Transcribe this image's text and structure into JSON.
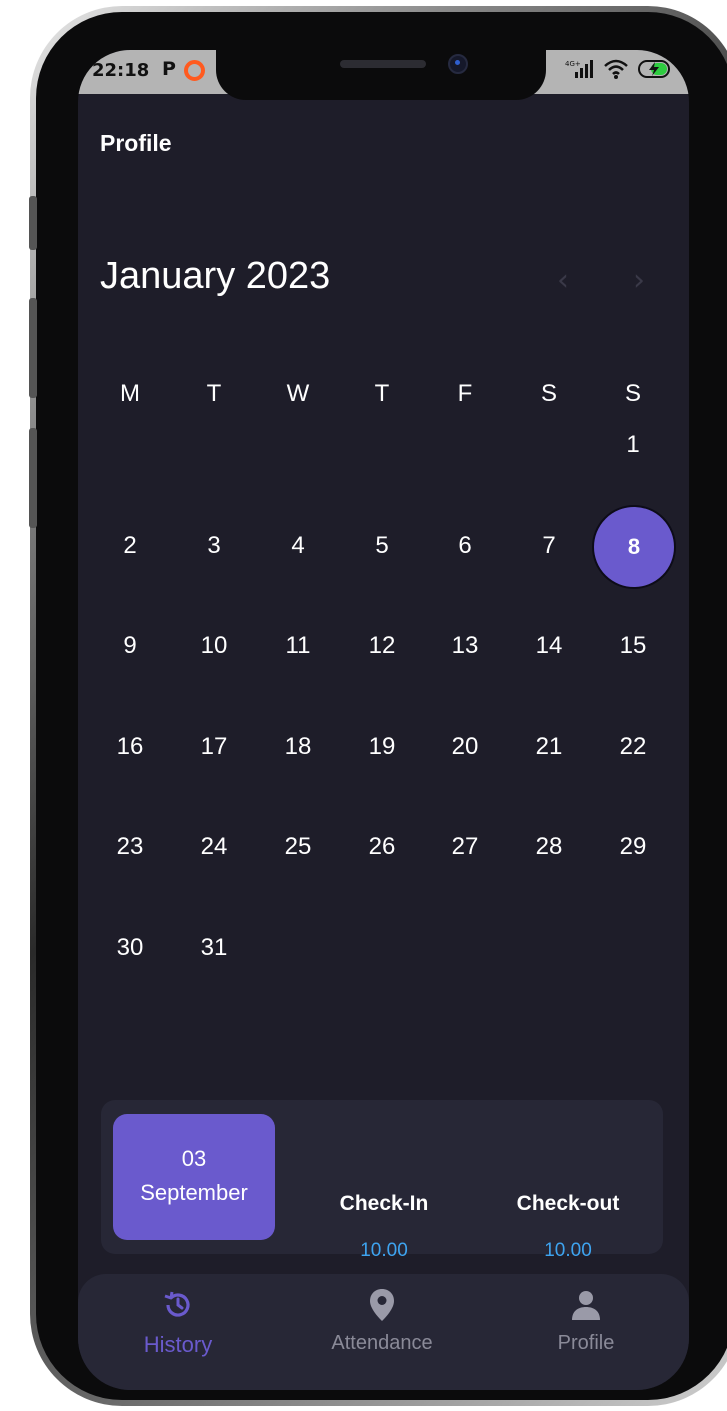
{
  "status_bar": {
    "time": "22:18",
    "left_icons": [
      "p-icon",
      "opera-icon"
    ],
    "right_icons": [
      "signal-icon",
      "wifi-icon",
      "battery-charging-icon"
    ]
  },
  "header": {
    "title": "Profile"
  },
  "calendar": {
    "month_title": "January 2023",
    "prev_icon": "chevron-left-icon",
    "next_icon": "chevron-right-icon",
    "weekdays": [
      "M",
      "T",
      "W",
      "T",
      "F",
      "S",
      "S"
    ],
    "selected_day": "8",
    "weeks": [
      [
        "",
        "",
        "",
        "",
        "",
        "",
        "1"
      ],
      [
        "2",
        "3",
        "4",
        "5",
        "6",
        "7",
        "8"
      ],
      [
        "9",
        "10",
        "11",
        "12",
        "13",
        "14",
        "15"
      ],
      [
        "16",
        "17",
        "18",
        "19",
        "20",
        "21",
        "22"
      ],
      [
        "23",
        "24",
        "25",
        "26",
        "27",
        "28",
        "29"
      ],
      [
        "30",
        "31",
        "",
        "",
        "",
        "",
        ""
      ]
    ]
  },
  "summary": {
    "day": "03",
    "month": "September",
    "check_in_label": "Check-In",
    "check_in_value": "10.00",
    "check_out_label": "Check-out",
    "check_out_value": "10.00"
  },
  "bottom_nav": {
    "items": [
      {
        "label": "History",
        "icon": "history-icon",
        "active": true
      },
      {
        "label": "Attendance",
        "icon": "location-pin-icon",
        "active": false
      },
      {
        "label": "Profile",
        "icon": "person-icon",
        "active": false
      }
    ]
  },
  "colors": {
    "background": "#1e1d29",
    "accent": "#6a5acd",
    "card": "#272736",
    "time_value": "#3ea4f0",
    "nav_inactive": "#8a8a98"
  }
}
